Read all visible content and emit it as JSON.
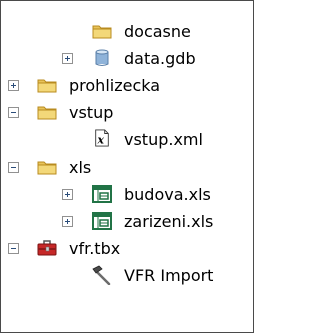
{
  "tree": {
    "items": [
      {
        "label": "docasne",
        "icon": "folder-icon",
        "expander": "none"
      },
      {
        "label": "data.gdb",
        "icon": "file-geodatabase-icon",
        "expander": "collapsed"
      },
      {
        "label": "prohlizecka",
        "icon": "folder-icon",
        "expander": "collapsed"
      },
      {
        "label": "vstup",
        "icon": "folder-icon",
        "expander": "expanded"
      },
      {
        "label": "vstup.xml",
        "icon": "xml-file-icon",
        "expander": "none"
      },
      {
        "label": "xls",
        "icon": "folder-icon",
        "expander": "expanded"
      },
      {
        "label": "budova.xls",
        "icon": "excel-table-icon",
        "expander": "collapsed"
      },
      {
        "label": "zarizeni.xls",
        "icon": "excel-table-icon",
        "expander": "collapsed"
      },
      {
        "label": "vfr.tbx",
        "icon": "toolbox-icon",
        "expander": "expanded"
      },
      {
        "label": "VFR Import",
        "icon": "tool-hammer-icon",
        "expander": "none"
      }
    ]
  },
  "colors": {
    "folder": "#e8c35a",
    "folder_edge": "#b88b1f",
    "geodatabase": "#8fb3d9",
    "excel_green": "#217346",
    "toolbox_red": "#c62828",
    "expander_border": "#919191",
    "expander_sign": "#2b4d7a"
  }
}
